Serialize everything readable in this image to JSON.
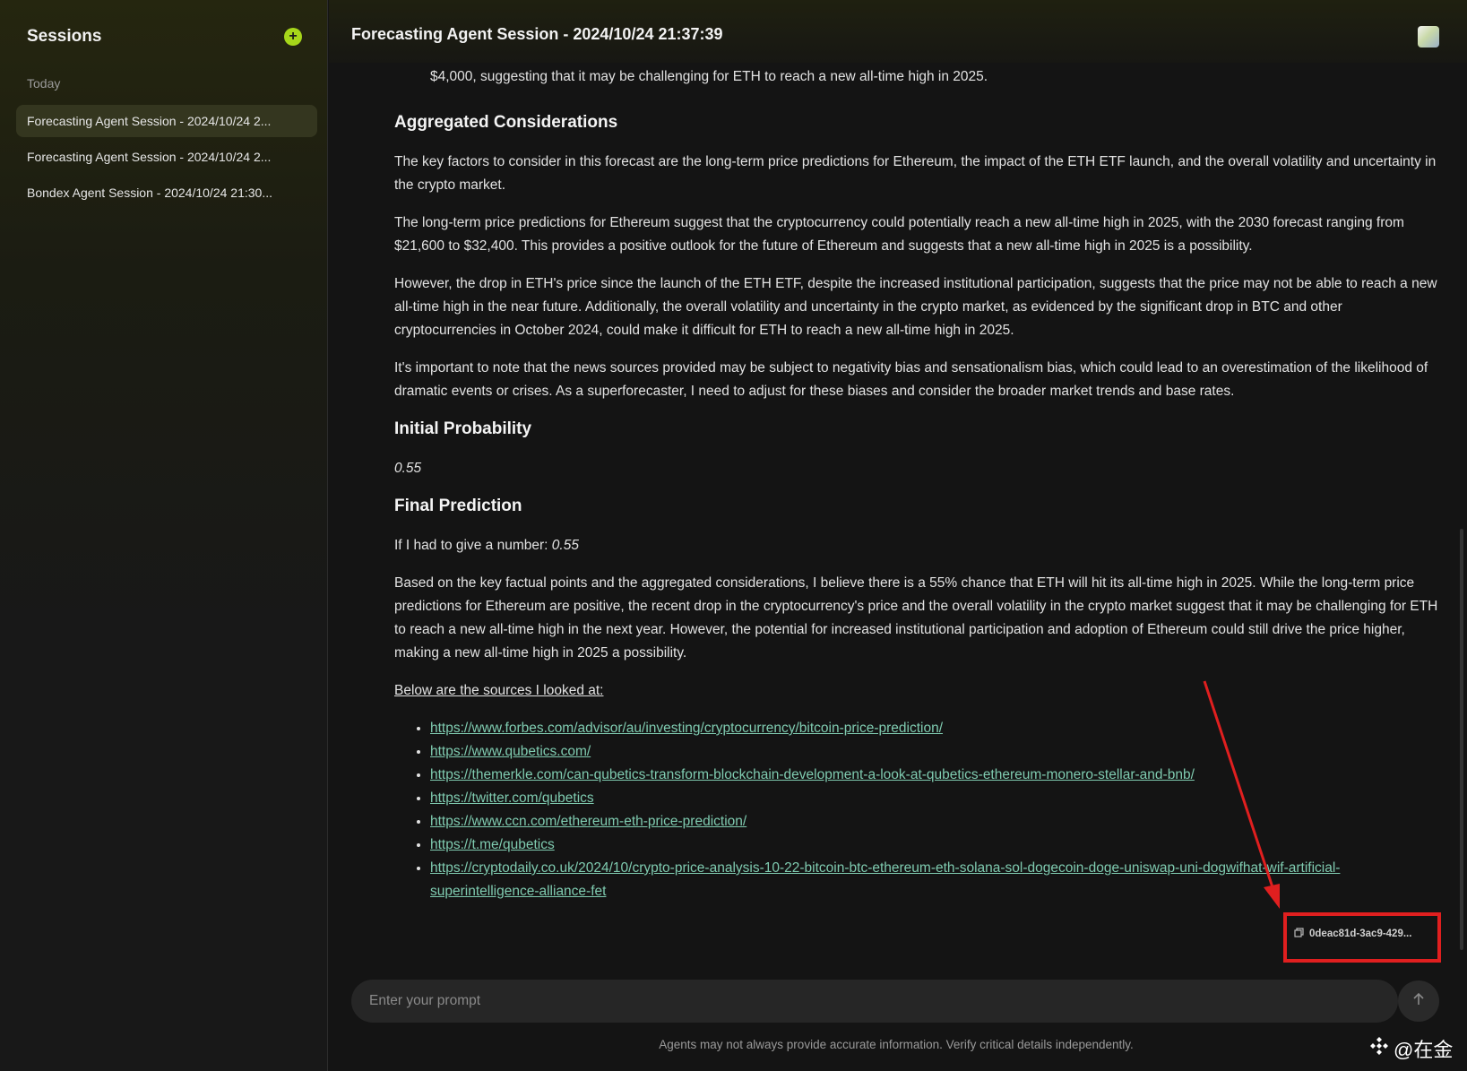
{
  "sidebar": {
    "title": "Sessions",
    "new_icon": "plus-icon",
    "group_label": "Today",
    "items": [
      {
        "label": "Forecasting Agent Session - 2024/10/24 2..."
      },
      {
        "label": "Forecasting Agent Session - 2024/10/24 2..."
      },
      {
        "label": "Bondex Agent Session - 2024/10/24 21:30..."
      }
    ]
  },
  "header": {
    "title": "Forecasting Agent Session - 2024/10/24 21:37:39"
  },
  "content": {
    "top_line": "$4,000, suggesting that it may be challenging for ETH to reach a new all-time high in 2025.",
    "h_aggregated": "Aggregated Considerations",
    "p1": "The key factors to consider in this forecast are the long-term price predictions for Ethereum, the impact of the ETH ETF launch, and the overall volatility and uncertainty in the crypto market.",
    "p2": "The long-term price predictions for Ethereum suggest that the cryptocurrency could potentially reach a new all-time high in 2025, with the 2030 forecast ranging from $21,600 to $32,400. This provides a positive outlook for the future of Ethereum and suggests that a new all-time high in 2025 is a possibility.",
    "p3": "However, the drop in ETH's price since the launch of the ETH ETF, despite the increased institutional participation, suggests that the price may not be able to reach a new all-time high in the near future. Additionally, the overall volatility and uncertainty in the crypto market, as evidenced by the significant drop in BTC and other cryptocurrencies in October 2024, could make it difficult for ETH to reach a new all-time high in 2025.",
    "p4": "It's important to note that the news sources provided may be subject to negativity bias and sensationalism bias, which could lead to an overestimation of the likelihood of dramatic events or crises. As a superforecaster, I need to adjust for these biases and consider the broader market trends and base rates.",
    "h_initial": "Initial Probability",
    "initial_value": "0.55",
    "h_final": "Final Prediction",
    "final_prefix": "If I had to give a number: ",
    "final_value": "0.55",
    "p5": "Based on the key factual points and the aggregated considerations, I believe there is a 55% chance that ETH will hit its all-time high in 2025. While the long-term price predictions for Ethereum are positive, the recent drop in the cryptocurrency's price and the overall volatility in the crypto market suggest that it may be challenging for ETH to reach a new all-time high in the next year. However, the potential for increased institutional participation and adoption of Ethereum could still drive the price higher, making a new all-time high in 2025 a possibility.",
    "sources_label": "Below are the sources I looked at:",
    "sources": [
      "https://www.forbes.com/advisor/au/investing/cryptocurrency/bitcoin-price-prediction/",
      "https://www.qubetics.com/",
      "https://themerkle.com/can-qubetics-transform-blockchain-development-a-look-at-qubetics-ethereum-monero-stellar-and-bnb/",
      "https://twitter.com/qubetics",
      "https://www.ccn.com/ethereum-eth-price-prediction/",
      "https://t.me/qubetics",
      "https://cryptodaily.co.uk/2024/10/crypto-price-analysis-10-22-bitcoin-btc-ethereum-eth-solana-sol-dogecoin-doge-uniswap-uni-dogwifhat-wif-artificial-superintelligence-alliance-fet"
    ],
    "message_id": "0deac81d-3ac9-429...",
    "message_id_icon": "copy-icon"
  },
  "prompt": {
    "placeholder": "Enter your prompt",
    "send_icon": "arrow-up-icon"
  },
  "footer": {
    "disclaimer": "Agents may not always provide accurate information. Verify critical details independently."
  },
  "watermark": {
    "text": "@在金"
  },
  "colors": {
    "accent": "#a6d61a",
    "link": "#7fcbb0",
    "annotation": "#e01f1f"
  }
}
